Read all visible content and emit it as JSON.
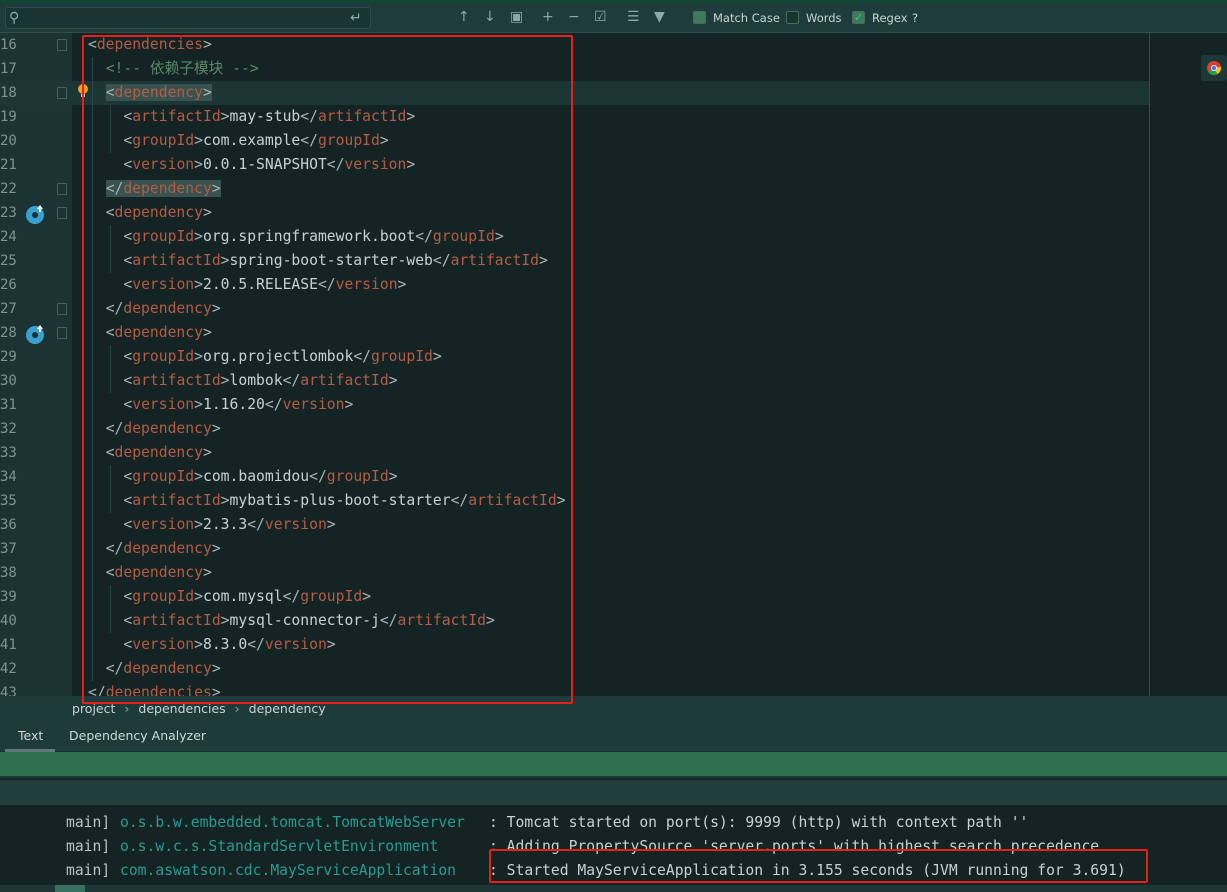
{
  "findbar": {
    "search_value": "",
    "options": [
      {
        "label": "Match Case",
        "checked": false
      },
      {
        "label": "Words",
        "checked": false
      },
      {
        "label": "Regex",
        "checked": true
      }
    ],
    "help": "?"
  },
  "editor": {
    "lines": [
      {
        "num": "16",
        "indent": 0,
        "kind": "open",
        "tag": "dependencies"
      },
      {
        "num": "17",
        "indent": 1,
        "kind": "comment",
        "text": "<!-- 依赖子模块 -->"
      },
      {
        "num": "18",
        "indent": 1,
        "kind": "open",
        "tag": "dependency",
        "current": true,
        "highlight": true
      },
      {
        "num": "19",
        "indent": 2,
        "kind": "elem",
        "tag": "artifactId",
        "value": "may-stub"
      },
      {
        "num": "20",
        "indent": 2,
        "kind": "elem",
        "tag": "groupId",
        "value": "com.example"
      },
      {
        "num": "21",
        "indent": 2,
        "kind": "elem",
        "tag": "version",
        "value": "0.0.1-SNAPSHOT"
      },
      {
        "num": "22",
        "indent": 1,
        "kind": "close",
        "tag": "dependency",
        "highlight": true
      },
      {
        "num": "23",
        "indent": 1,
        "kind": "open",
        "tag": "dependency"
      },
      {
        "num": "24",
        "indent": 2,
        "kind": "elem",
        "tag": "groupId",
        "value": "org.springframework.boot"
      },
      {
        "num": "25",
        "indent": 2,
        "kind": "elem",
        "tag": "artifactId",
        "value": "spring-boot-starter-web"
      },
      {
        "num": "26",
        "indent": 2,
        "kind": "elem",
        "tag": "version",
        "value": "2.0.5.RELEASE"
      },
      {
        "num": "27",
        "indent": 1,
        "kind": "close",
        "tag": "dependency"
      },
      {
        "num": "28",
        "indent": 1,
        "kind": "open",
        "tag": "dependency"
      },
      {
        "num": "29",
        "indent": 2,
        "kind": "elem",
        "tag": "groupId",
        "value": "org.projectlombok"
      },
      {
        "num": "30",
        "indent": 2,
        "kind": "elem",
        "tag": "artifactId",
        "value": "lombok"
      },
      {
        "num": "31",
        "indent": 2,
        "kind": "elem",
        "tag": "version",
        "value": "1.16.20"
      },
      {
        "num": "32",
        "indent": 1,
        "kind": "close",
        "tag": "dependency"
      },
      {
        "num": "33",
        "indent": 1,
        "kind": "open",
        "tag": "dependency"
      },
      {
        "num": "34",
        "indent": 2,
        "kind": "elem",
        "tag": "groupId",
        "value": "com.baomidou"
      },
      {
        "num": "35",
        "indent": 2,
        "kind": "elem",
        "tag": "artifactId",
        "value": "mybatis-plus-boot-starter"
      },
      {
        "num": "36",
        "indent": 2,
        "kind": "elem",
        "tag": "version",
        "value": "2.3.3"
      },
      {
        "num": "37",
        "indent": 1,
        "kind": "close",
        "tag": "dependency"
      },
      {
        "num": "38",
        "indent": 1,
        "kind": "open",
        "tag": "dependency"
      },
      {
        "num": "39",
        "indent": 2,
        "kind": "elem",
        "tag": "groupId",
        "value": "com.mysql"
      },
      {
        "num": "40",
        "indent": 2,
        "kind": "elem",
        "tag": "artifactId",
        "value": "mysql-connector-j"
      },
      {
        "num": "41",
        "indent": 2,
        "kind": "elem",
        "tag": "version",
        "value": "8.3.0"
      },
      {
        "num": "42",
        "indent": 1,
        "kind": "close",
        "tag": "dependency"
      },
      {
        "num": "43",
        "indent": 0,
        "kind": "close",
        "tag": "dependencies"
      }
    ],
    "fold_lines": [
      "16",
      "18",
      "22",
      "23",
      "27",
      "28"
    ],
    "gutter_icons": [
      {
        "line": "18",
        "icon": "lightbulb-icon"
      },
      {
        "line": "23",
        "icon": "maven-upgrade-icon"
      },
      {
        "line": "28",
        "icon": "maven-upgrade-icon"
      }
    ]
  },
  "breadcrumb": [
    "project",
    "dependencies",
    "dependency"
  ],
  "tabs": [
    {
      "label": "Text",
      "active": true
    },
    {
      "label": "Dependency Analyzer",
      "active": false
    }
  ],
  "console": [
    {
      "thread": "main]",
      "logger": "o.s.b.w.embedded.tomcat.TomcatWebServer",
      "message": ": Tomcat started on port(s): 9999 (http) with context path ''"
    },
    {
      "thread": "main]",
      "logger": "o.s.w.c.s.StandardServletEnvironment",
      "message": ": Adding PropertySource 'server.ports' with highest search precedence"
    },
    {
      "thread": "main]",
      "logger": "com.aswatson.cdc.MayServiceApplication",
      "message": ": Started MayServiceApplication in 3.155 seconds (JVM running for 3.691)"
    }
  ],
  "colors": {
    "tag": "#b55c44",
    "comment": "#5a8a6a",
    "logger": "#2a9a92",
    "annotation": "#e8201a",
    "status_bar": "#2e7050"
  }
}
